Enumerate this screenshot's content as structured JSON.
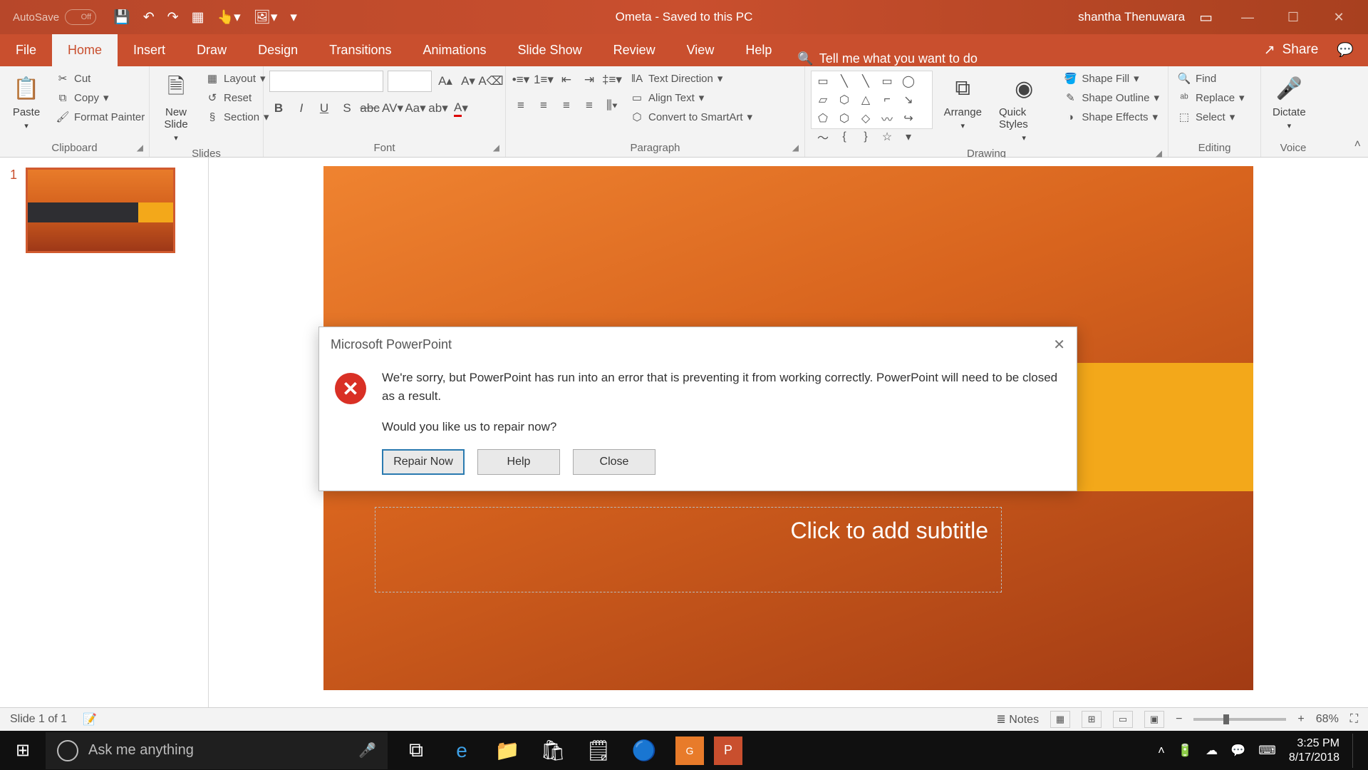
{
  "titlebar": {
    "autosave_label": "AutoSave",
    "autosave_state": "Off",
    "doc_title": "Ometa  -  Saved to this PC",
    "user": "shantha Thenuwara"
  },
  "tabs": {
    "file": "File",
    "home": "Home",
    "insert": "Insert",
    "draw": "Draw",
    "design": "Design",
    "transitions": "Transitions",
    "animations": "Animations",
    "slideshow": "Slide Show",
    "review": "Review",
    "view": "View",
    "help": "Help",
    "tellme": "Tell me what you want to do",
    "share": "Share"
  },
  "ribbon": {
    "clipboard": {
      "paste": "Paste",
      "cut": "Cut",
      "copy": "Copy",
      "painter": "Format Painter",
      "label": "Clipboard"
    },
    "slides": {
      "new": "New Slide",
      "layout": "Layout",
      "reset": "Reset",
      "section": "Section",
      "label": "Slides"
    },
    "font": {
      "label": "Font"
    },
    "paragraph": {
      "textdir": "Text Direction",
      "align": "Align Text",
      "smartart": "Convert to SmartArt",
      "label": "Paragraph"
    },
    "drawing": {
      "arrange": "Arrange",
      "quick": "Quick Styles",
      "fill": "Shape Fill",
      "outline": "Shape Outline",
      "effects": "Shape Effects",
      "label": "Drawing"
    },
    "editing": {
      "find": "Find",
      "replace": "Replace",
      "select": "Select",
      "label": "Editing"
    },
    "voice": {
      "dictate": "Dictate",
      "label": "Voice"
    }
  },
  "thumb": {
    "num": "1"
  },
  "slide": {
    "subtitle": "Click to add subtitle"
  },
  "dialog": {
    "title": "Microsoft PowerPoint",
    "msg1": "We're sorry, but PowerPoint has run into an error that is preventing it from working correctly. PowerPoint will need to be closed as a result.",
    "msg2": "Would you like us to repair now?",
    "repair": "Repair Now",
    "help": "Help",
    "close": "Close"
  },
  "status": {
    "slide": "Slide 1 of 1",
    "notes": "Notes",
    "zoom": "68%"
  },
  "taskbar": {
    "search": "Ask me anything",
    "time": "3:25 PM",
    "date": "8/17/2018"
  }
}
